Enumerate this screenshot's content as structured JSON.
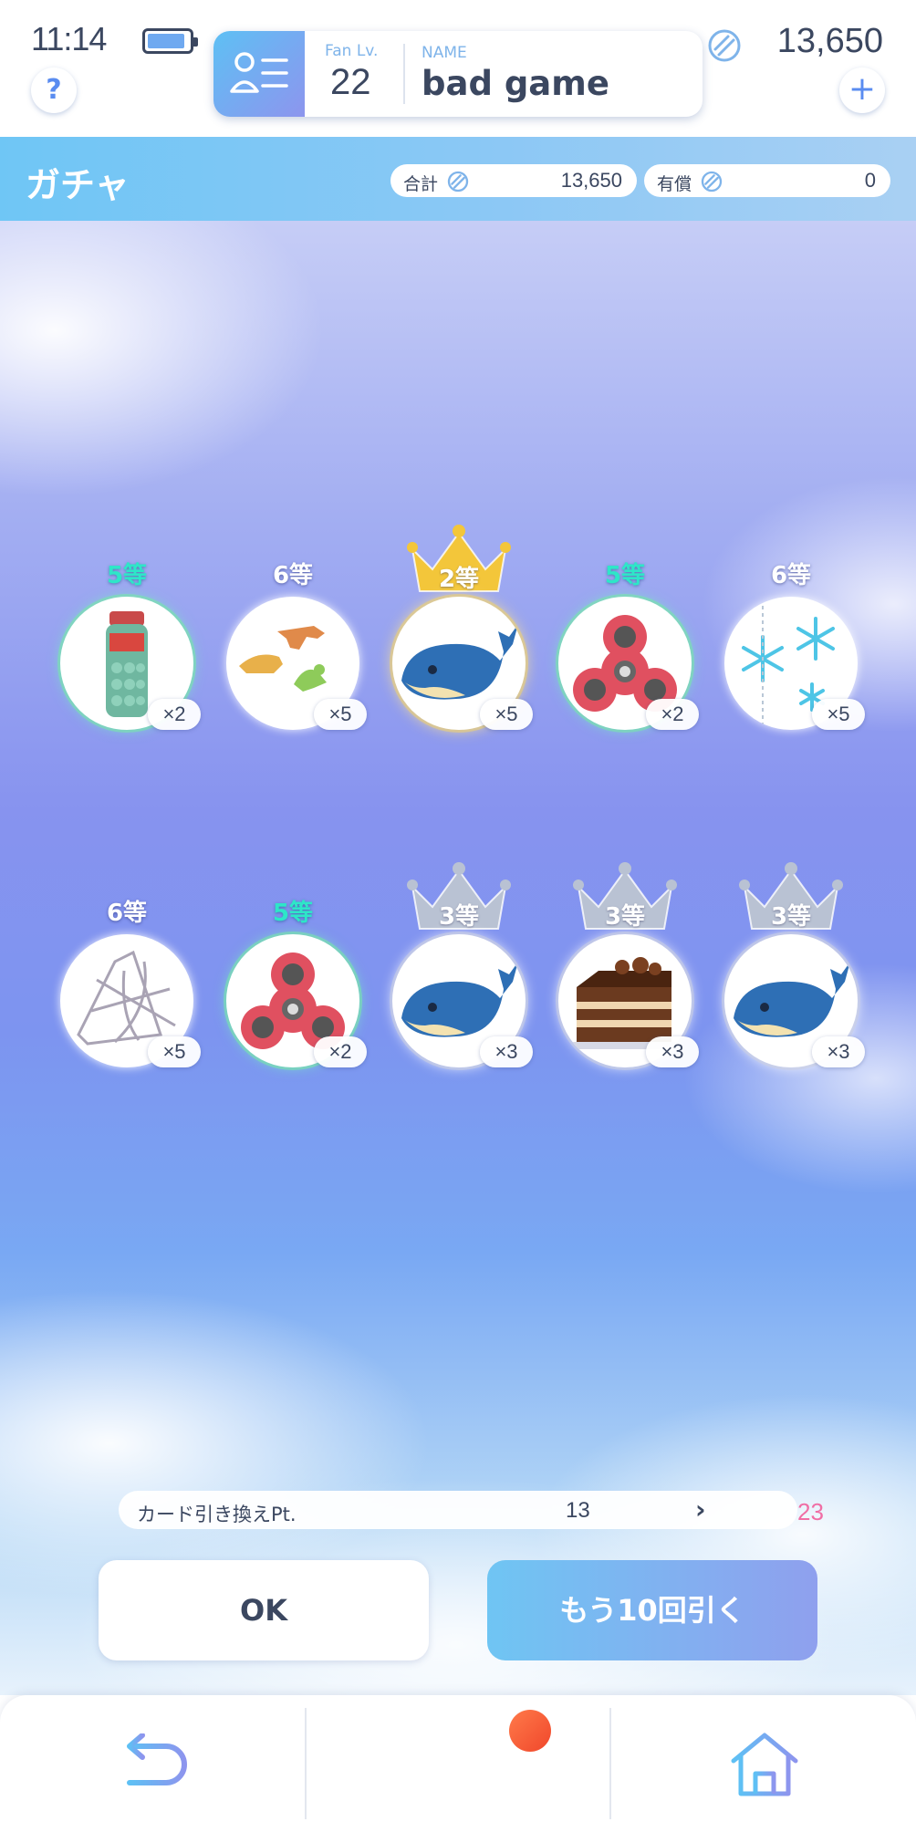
{
  "status": {
    "time": "11:14",
    "battery_level": 0.9
  },
  "profile": {
    "fan_lv_label": "Fan Lv.",
    "fan_lv_value": "22",
    "name_label": "NAME",
    "name_value": "bad game"
  },
  "currency": {
    "total": "13,650",
    "add_label": "+"
  },
  "help_label": "?",
  "header": {
    "title": "ガチャ",
    "total_label": "合計",
    "total_value": "13,650",
    "paid_label": "有償",
    "paid_value": "0"
  },
  "results": [
    {
      "rank": "5等",
      "count": "×2",
      "item_icon": "ramune-bottle-icon",
      "tier": "teal"
    },
    {
      "rank": "6等",
      "count": "×5",
      "item_icon": "dinosaur-figures-icon",
      "tier": "white"
    },
    {
      "rank": "2等",
      "count": "×5",
      "item_icon": "whale-plush-icon",
      "tier": "gold"
    },
    {
      "rank": "5等",
      "count": "×2",
      "item_icon": "fidget-spinner-icon",
      "tier": "teal"
    },
    {
      "rank": "6等",
      "count": "×5",
      "item_icon": "snowflake-ornament-icon",
      "tier": "white"
    },
    {
      "rank": "6等",
      "count": "×5",
      "item_icon": "wire-sketch-icon",
      "tier": "white"
    },
    {
      "rank": "5等",
      "count": "×2",
      "item_icon": "fidget-spinner-icon",
      "tier": "teal"
    },
    {
      "rank": "3等",
      "count": "×3",
      "item_icon": "whale-plush-icon",
      "tier": "silver"
    },
    {
      "rank": "3等",
      "count": "×3",
      "item_icon": "chocolate-cake-icon",
      "tier": "silver"
    },
    {
      "rank": "3等",
      "count": "×3",
      "item_icon": "whale-plush-icon",
      "tier": "silver"
    }
  ],
  "points": {
    "label": "カード引き換えPt.",
    "before": "13",
    "arrow": "›",
    "after": "23"
  },
  "buttons": {
    "ok": "OK",
    "draw_again": "もう10回引く"
  },
  "nav": {
    "back_icon": "back-arrow-icon",
    "menu_icon": "menu-icon",
    "home_icon": "home-icon"
  },
  "colors": {
    "accent_blue": "#5a8cf0",
    "points_after": "#f06ea5",
    "rank_teal": "#2ee6c8",
    "crown_gold": "#f3c63a",
    "crown_silver": "#b9c2d3"
  }
}
